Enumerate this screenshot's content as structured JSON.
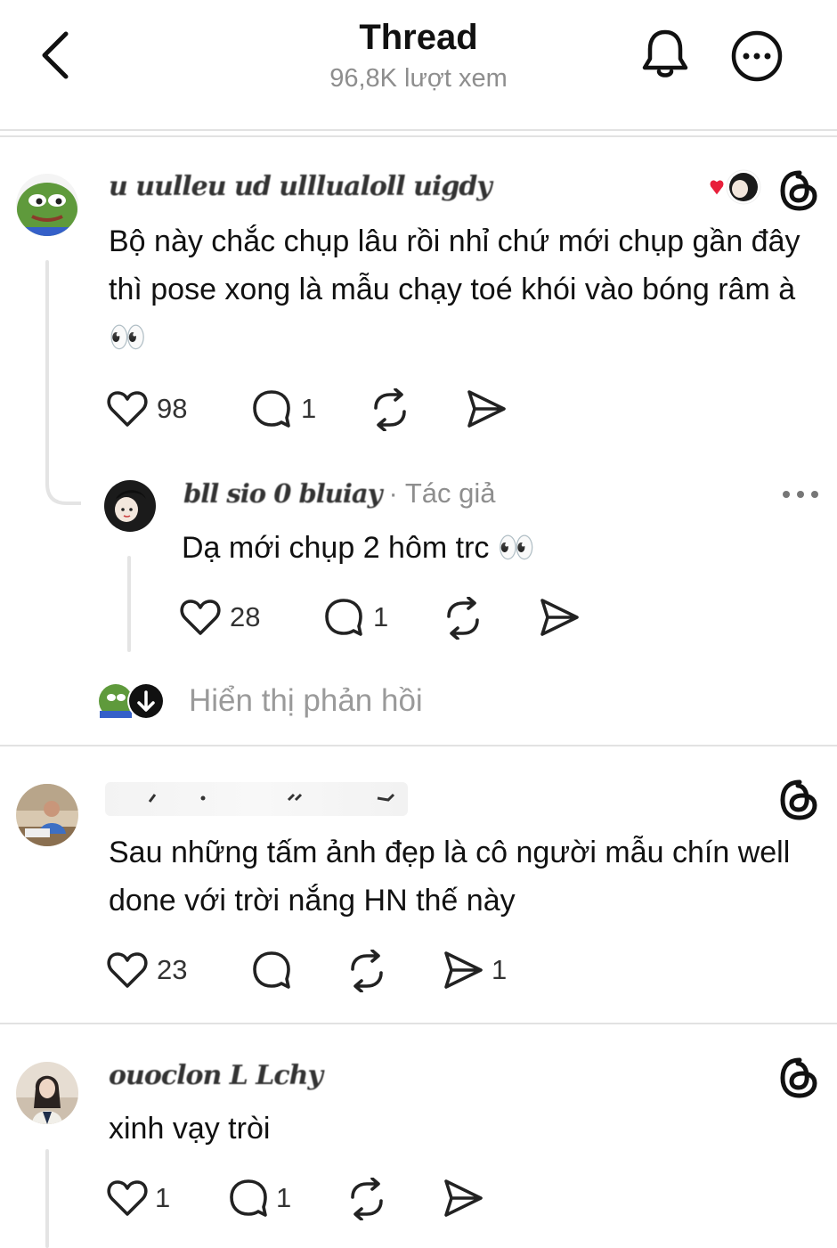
{
  "header": {
    "title": "Thread",
    "views": "96,8K lượt xem"
  },
  "comments": [
    {
      "author": "u uulleu ud ulllualoll uigdy",
      "text": "Bộ này chắc chụp lâu rồi nhỉ chứ mới chụp gần đây thì pose xong là mẫu chạy toé khói vào bóng râm à 👀",
      "likes": "98",
      "replies": "1",
      "reply": {
        "author": "bll sio 0 bluiay",
        "badge": "· Tác giả",
        "text": "Dạ mới chụp 2 hôm trc 👀",
        "likes": "28",
        "replies": "1"
      },
      "show_replies": "Hiển thị phản hồi"
    },
    {
      "author": "",
      "text": "Sau những tấm ảnh đẹp là cô người mẫu chín well done với trời nắng HN thế này",
      "likes": "23",
      "shares": "1"
    },
    {
      "author": "ouoclon L Lchy",
      "text": "xinh vạy tròi",
      "likes": "1",
      "replies": "1"
    }
  ],
  "colors": {
    "like_heart": "#e8203b",
    "muted": "#8e8e8e"
  }
}
